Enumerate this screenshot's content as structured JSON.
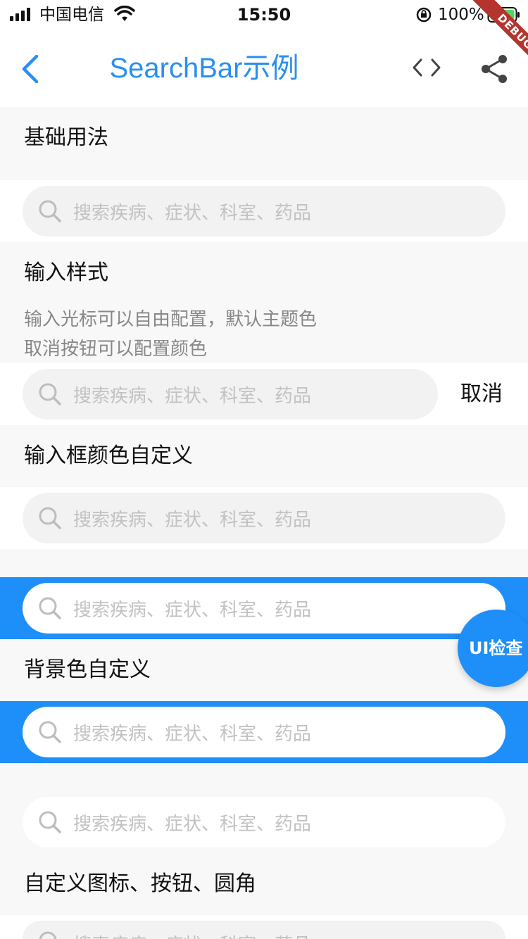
{
  "status_bar": {
    "carrier": "中国电信",
    "time": "15:50",
    "battery": "100%"
  },
  "nav": {
    "title": "SearchBar示例",
    "debug_label": "DEBUG"
  },
  "sections": {
    "basic": {
      "heading": "基础用法"
    },
    "input_style": {
      "heading": "输入样式",
      "desc_line1": "输入光标可以自由配置，默认主题色",
      "desc_line2": "取消按钮可以配置颜色",
      "cancel_label": "取消"
    },
    "input_color": {
      "heading": "输入框颜色自定义"
    },
    "bg_color": {
      "heading": "背景色自定义"
    },
    "custom_icon": {
      "heading": "自定义图标、按钮、圆角"
    }
  },
  "search": {
    "placeholder": "搜索疾病、症状、科室、药品"
  },
  "fab": {
    "label": "UI检查"
  },
  "colors": {
    "accent": "#1e8ef8",
    "title": "#2a8ff0"
  },
  "icons": [
    "signal-icon",
    "wifi-icon",
    "lock-rotation-icon",
    "battery-icon",
    "back-icon",
    "code-icon",
    "share-icon",
    "search-icon"
  ]
}
